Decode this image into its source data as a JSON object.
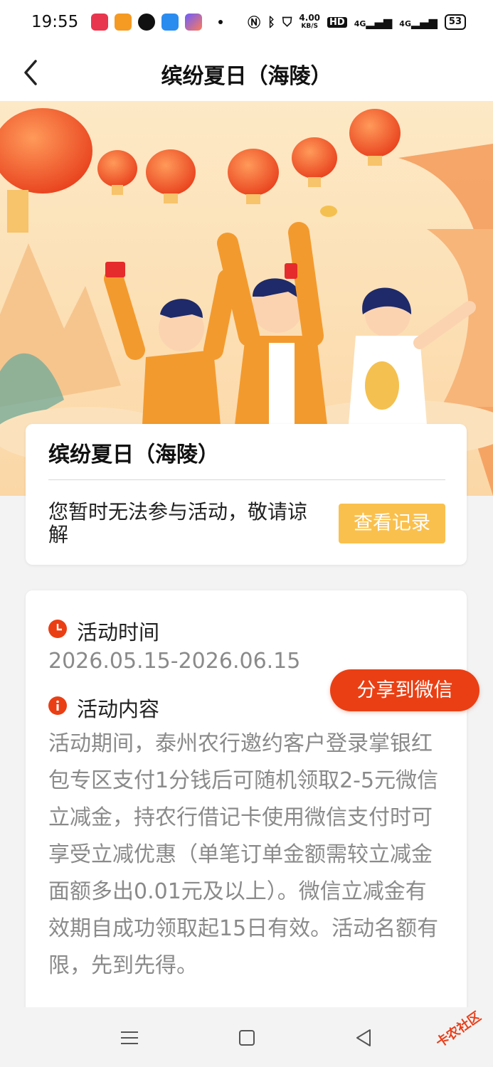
{
  "status_bar": {
    "time": "19:55",
    "net_speed_value": "4.00",
    "net_speed_unit": "KB/S",
    "hd_badge": "HD",
    "signal_1": "4G",
    "signal_2": "4G",
    "battery": "53",
    "icons": [
      "music-app-icon",
      "app-icon",
      "telegram-icon",
      "wallet-icon",
      "shortcut-icon",
      "nfc-icon",
      "bluetooth-icon",
      "security-icon"
    ]
  },
  "header": {
    "title": "缤纷夏日（海陵）",
    "back_icon": "chevron-left-icon"
  },
  "info_card": {
    "title": "缤纷夏日（海陵）",
    "message": "您暂时无法参与活动，敬请谅解",
    "record_button": "查看记录"
  },
  "detail": {
    "time_label": "活动时间",
    "time_value": "2026.05.15-2026.06.15",
    "content_label": "活动内容",
    "content_text": "活动期间，泰州农行邀约客户登录掌银红包专区支付1分钱后可随机领取2-5元微信立减金，持农行借记卡使用微信支付时可享受立减优惠（单笔订单金额需较立减金面额多出0.01元及以上）。微信立减金有效期自成功领取起15日有效。活动名额有限，先到先得。"
  },
  "share_button": "分享到微信",
  "watermark": "卡农社区",
  "colors": {
    "accent_orange": "#ea3f14",
    "button_yellow": "#fac04d",
    "banner_bg": "#fde4b8"
  }
}
